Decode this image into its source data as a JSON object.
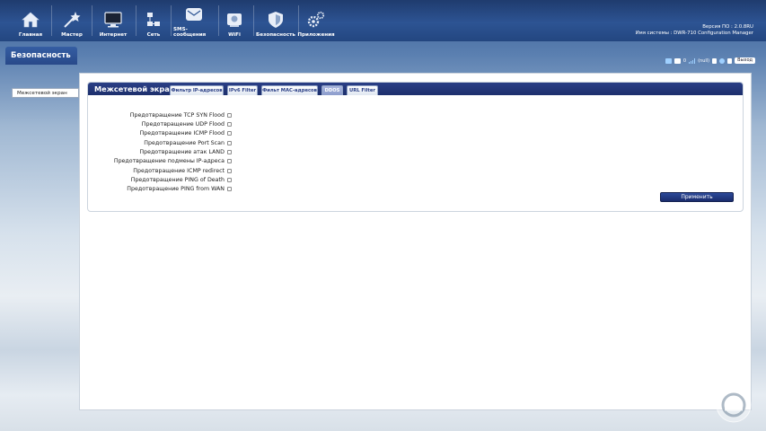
{
  "nav": [
    {
      "label": "Главная",
      "icon": "home-icon"
    },
    {
      "label": "Мастер",
      "icon": "wizard-icon"
    },
    {
      "label": "Интернет",
      "icon": "monitor-icon"
    },
    {
      "label": "Сеть",
      "icon": "network-icon"
    },
    {
      "label": "SMS-сообщения",
      "icon": "envelope-icon"
    },
    {
      "label": "WiFi",
      "icon": "wifi-icon"
    },
    {
      "label": "Безопасность",
      "icon": "shield-icon"
    },
    {
      "label": "Приложения",
      "icon": "gears-icon"
    }
  ],
  "sysinfo": {
    "version": "Версия ПО : 2.0.8RU",
    "system_name": "Имя системы : DWR-710 Configuration Manager"
  },
  "section_title": "Безопасность",
  "sidebar": {
    "items": [
      {
        "label": "Межсетевой экран"
      }
    ]
  },
  "status": {
    "sms_count": "0",
    "signal": "(null)",
    "logout_label": "Выход"
  },
  "firewall": {
    "title": "Межсетевой экран",
    "tabs": [
      {
        "label": "Фильтр IP-адресов",
        "active": false
      },
      {
        "label": "IPv6 Filter",
        "active": false
      },
      {
        "label": "Фильт MAC-адресов",
        "active": false
      },
      {
        "label": "DDOS",
        "active": true
      },
      {
        "label": "URL Filter",
        "active": false
      }
    ],
    "options": [
      {
        "label": "Предотвращение TCP SYN Flood",
        "checked": false
      },
      {
        "label": "Предотвращение UDP Flood",
        "checked": false
      },
      {
        "label": "Предотвращение ICMP Flood",
        "checked": false
      },
      {
        "label": "Предотвращение Port Scan",
        "checked": false
      },
      {
        "label": "Предотвращение атак LAND",
        "checked": false
      },
      {
        "label": "Предотвращение подмены IP-адреса",
        "checked": false
      },
      {
        "label": "Предотвращение ICMP redirect",
        "checked": false
      },
      {
        "label": "Предотвращение PING of Death",
        "checked": false
      },
      {
        "label": "Предотвращение PING from WAN",
        "checked": false
      }
    ],
    "apply_label": "Применить"
  },
  "colors": {
    "accent": "#1d2f6c",
    "topbar": "#2d5493"
  }
}
